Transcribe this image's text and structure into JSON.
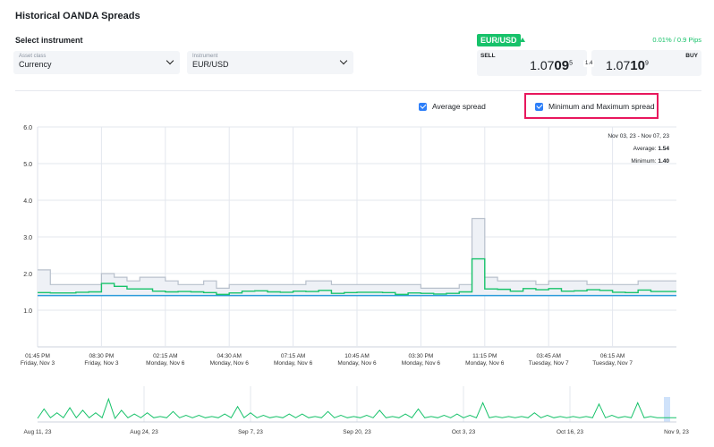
{
  "title": "Historical OANDA Spreads",
  "select_label": "Select instrument",
  "asset_class": {
    "label": "Asset class",
    "value": "Currency"
  },
  "instrument": {
    "label": "Instrument",
    "value": "EUR/USD"
  },
  "quote": {
    "pair": "EUR/USD",
    "direction": "up",
    "change": "0.01% / 0.9 Pips",
    "sell_label": "SELL",
    "sell_prefix": "1.07",
    "sell_big": "09",
    "sell_pip": "5",
    "buy_label": "BUY",
    "buy_prefix": "1.07",
    "buy_big": "10",
    "buy_pip": "9",
    "spread": "1.4"
  },
  "checkboxes": {
    "average": {
      "label": "Average spread",
      "checked": true
    },
    "minmax": {
      "label": "Minimum and Maximum spread",
      "checked": true
    }
  },
  "info": {
    "range": "Nov 03, 23 - Nov 07, 23",
    "average_label": "Average:",
    "average": "1.54",
    "minimum_label": "Minimum:",
    "minimum": "1.40"
  },
  "colors": {
    "accent": "#17c26a",
    "average": "#17c26a",
    "minimum": "#2d9cdb",
    "range_fill": "#eef1f6",
    "range_line": "#b8c0cc",
    "highlight": "#e8175d"
  },
  "chart_data": [
    {
      "type": "line",
      "ylim": [
        0,
        6
      ],
      "yticks": [
        "1.0",
        "2.0",
        "3.0",
        "4.0",
        "5.0",
        "6.0"
      ],
      "yvals": [
        1,
        2,
        3,
        4,
        5,
        6
      ],
      "grid": true,
      "xticks": [
        [
          "01:45 PM",
          "Friday, Nov 3"
        ],
        [
          "08:30 PM",
          "Friday, Nov 3"
        ],
        [
          "02:15 AM",
          "Monday, Nov 6"
        ],
        [
          "04:30 AM",
          "Monday, Nov 6"
        ],
        [
          "07:15 AM",
          "Monday, Nov 6"
        ],
        [
          "10:45 AM",
          "Monday, Nov 6"
        ],
        [
          "03:30 PM",
          "Monday, Nov 6"
        ],
        [
          "11:15 PM",
          "Monday, Nov 6"
        ],
        [
          "03:45 AM",
          "Tuesday, Nov 7"
        ],
        [
          "06:15 AM",
          "Tuesday, Nov 7"
        ]
      ],
      "step": true,
      "series": [
        {
          "key": "max",
          "values": [
            2.1,
            1.7,
            1.7,
            1.7,
            1.7,
            2.0,
            1.9,
            1.8,
            1.9,
            1.9,
            1.8,
            1.7,
            1.7,
            1.8,
            1.6,
            1.7,
            1.7,
            1.7,
            1.7,
            1.7,
            1.7,
            1.8,
            1.8,
            1.7,
            1.7,
            1.7,
            1.7,
            1.7,
            1.7,
            1.7,
            1.6,
            1.6,
            1.6,
            1.7,
            3.5,
            1.9,
            1.8,
            1.8,
            1.8,
            1.7,
            1.8,
            1.8,
            1.8,
            1.7,
            1.7,
            1.7,
            1.7,
            1.8,
            1.8,
            1.8
          ]
        },
        {
          "key": "average",
          "values": [
            1.48,
            1.47,
            1.47,
            1.49,
            1.5,
            1.73,
            1.65,
            1.58,
            1.58,
            1.52,
            1.5,
            1.51,
            1.5,
            1.48,
            1.43,
            1.47,
            1.52,
            1.53,
            1.5,
            1.49,
            1.52,
            1.51,
            1.54,
            1.46,
            1.48,
            1.49,
            1.49,
            1.48,
            1.43,
            1.47,
            1.46,
            1.44,
            1.46,
            1.5,
            2.4,
            1.58,
            1.57,
            1.52,
            1.59,
            1.56,
            1.59,
            1.52,
            1.53,
            1.56,
            1.54,
            1.49,
            1.48,
            1.55,
            1.51,
            1.51
          ]
        },
        {
          "key": "min",
          "values": [
            1.4,
            1.4,
            1.4,
            1.4,
            1.4,
            1.4,
            1.4,
            1.4,
            1.4,
            1.4,
            1.4,
            1.4,
            1.4,
            1.4,
            1.4,
            1.4,
            1.4,
            1.4,
            1.4,
            1.4,
            1.4,
            1.4,
            1.4,
            1.4,
            1.4,
            1.4,
            1.4,
            1.4,
            1.4,
            1.4,
            1.4,
            1.4,
            1.4,
            1.4,
            1.4,
            1.4,
            1.4,
            1.4,
            1.4,
            1.4,
            1.4,
            1.4,
            1.4,
            1.4,
            1.4,
            1.4,
            1.4,
            1.4,
            1.4,
            1.4
          ]
        }
      ]
    },
    {
      "type": "line",
      "role": "navigator",
      "xticks": [
        "Aug 11, 23",
        "Aug 24, 23",
        "Sep 7, 23",
        "Sep 20, 23",
        "Oct 3, 23",
        "Oct 16, 23",
        "Nov 9, 23"
      ],
      "values": [
        1.5,
        3.0,
        1.6,
        2.4,
        1.6,
        3.2,
        1.6,
        2.8,
        1.6,
        2.4,
        1.6,
        4.6,
        1.5,
        2.8,
        1.6,
        2.2,
        1.6,
        2.4,
        1.6,
        1.8,
        1.6,
        2.6,
        1.6,
        2.0,
        1.6,
        2.0,
        1.6,
        1.8,
        1.6,
        2.2,
        1.6,
        3.4,
        1.6,
        2.4,
        1.6,
        2.0,
        1.6,
        1.8,
        1.6,
        2.2,
        1.6,
        2.2,
        1.6,
        1.8,
        1.6,
        2.6,
        1.6,
        2.0,
        1.6,
        1.8,
        1.6,
        2.0,
        1.6,
        2.8,
        1.6,
        1.8,
        1.6,
        2.2,
        1.6,
        3.0,
        1.6,
        1.8,
        1.6,
        2.0,
        1.6,
        2.2,
        1.6,
        2.0,
        1.6,
        4.0,
        1.6,
        1.8,
        1.6,
        1.8,
        1.6,
        1.8,
        1.6,
        2.4,
        1.6,
        2.0,
        1.6,
        1.8,
        1.6,
        1.8,
        1.6,
        1.8,
        1.6,
        3.8,
        1.6,
        2.0,
        1.6,
        1.8,
        1.6,
        4.0,
        1.6,
        1.8,
        1.6,
        1.6,
        1.6,
        1.6
      ],
      "selected_range": "Nov 03, 23 - Nov 07, 23"
    }
  ]
}
